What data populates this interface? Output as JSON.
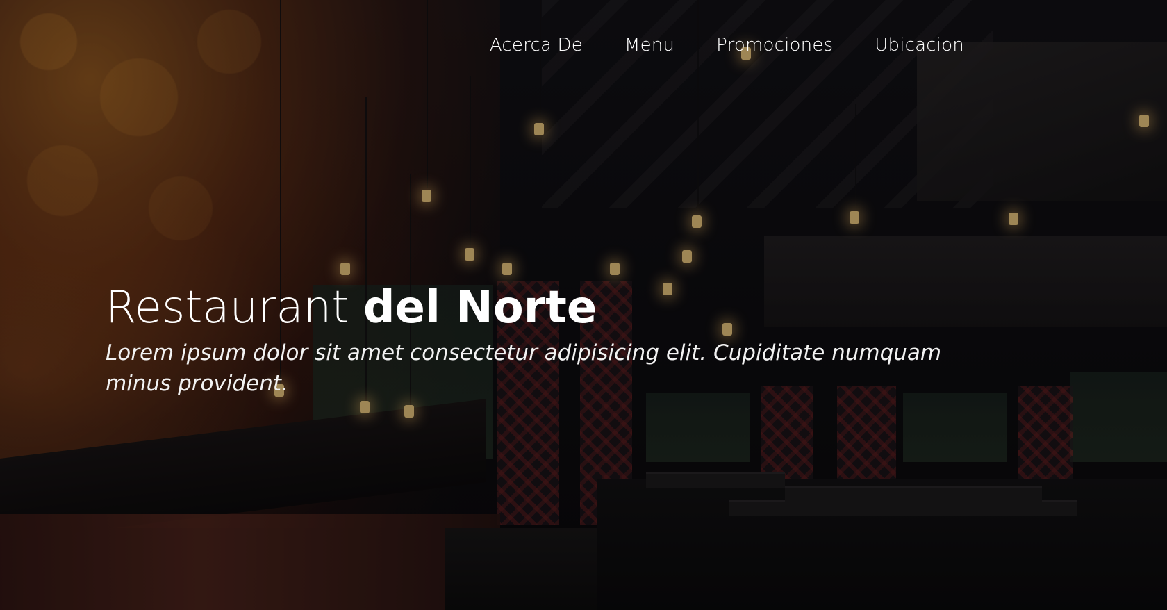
{
  "nav": {
    "items": [
      {
        "label": "Acerca De"
      },
      {
        "label": "Menu"
      },
      {
        "label": "Promociones"
      },
      {
        "label": "Ubicacion"
      }
    ]
  },
  "hero": {
    "title_light": "Restaurant ",
    "title_bold": "del Norte",
    "subtitle": "Lorem ipsum dolor sit amet consectetur adipisicing elit. Cupiditate numquam minus provident."
  },
  "colors": {
    "text": "#ffffff",
    "overlay": "#000000",
    "accent_warm": "#c8782a"
  }
}
